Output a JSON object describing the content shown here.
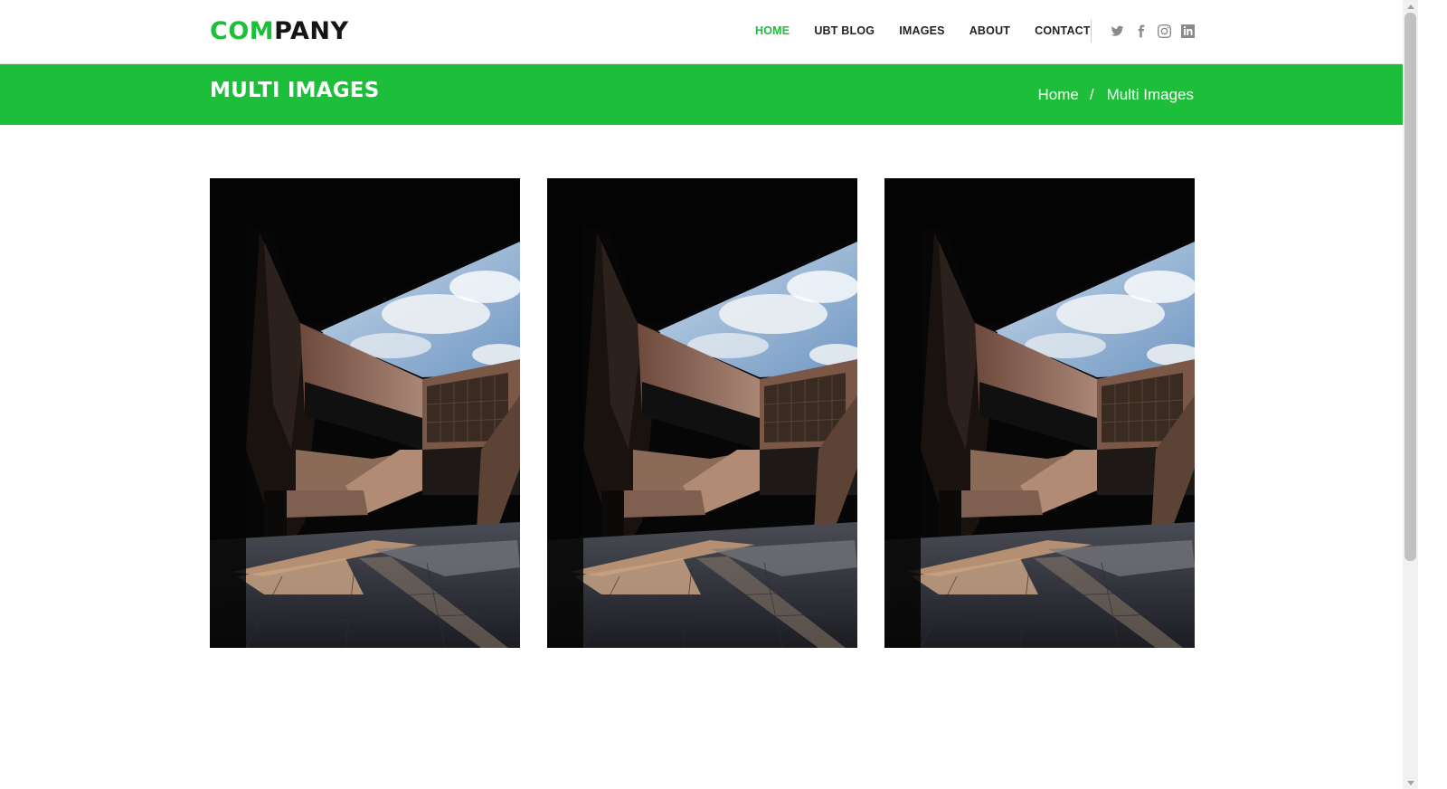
{
  "brand": {
    "accent_text": "COM",
    "rest_text": "PANY",
    "accent_color": "#1dbf3a"
  },
  "nav": {
    "items": [
      {
        "label": "HOME",
        "active": true
      },
      {
        "label": "UBT BLOG",
        "active": false
      },
      {
        "label": "IMAGES",
        "active": false
      },
      {
        "label": "ABOUT",
        "active": false
      },
      {
        "label": "CONTACT",
        "active": false
      }
    ]
  },
  "social": [
    "twitter-icon",
    "facebook-icon",
    "instagram-icon",
    "linkedin-icon"
  ],
  "banner": {
    "title": "MULTI IMAGES",
    "breadcrumb": {
      "home": "Home",
      "separator": "/",
      "current": "Multi Images"
    },
    "color": "#1dbf3a"
  },
  "gallery": {
    "images": [
      {
        "subject": "modern building courtyard"
      },
      {
        "subject": "modern building courtyard"
      },
      {
        "subject": "modern building courtyard"
      }
    ]
  }
}
